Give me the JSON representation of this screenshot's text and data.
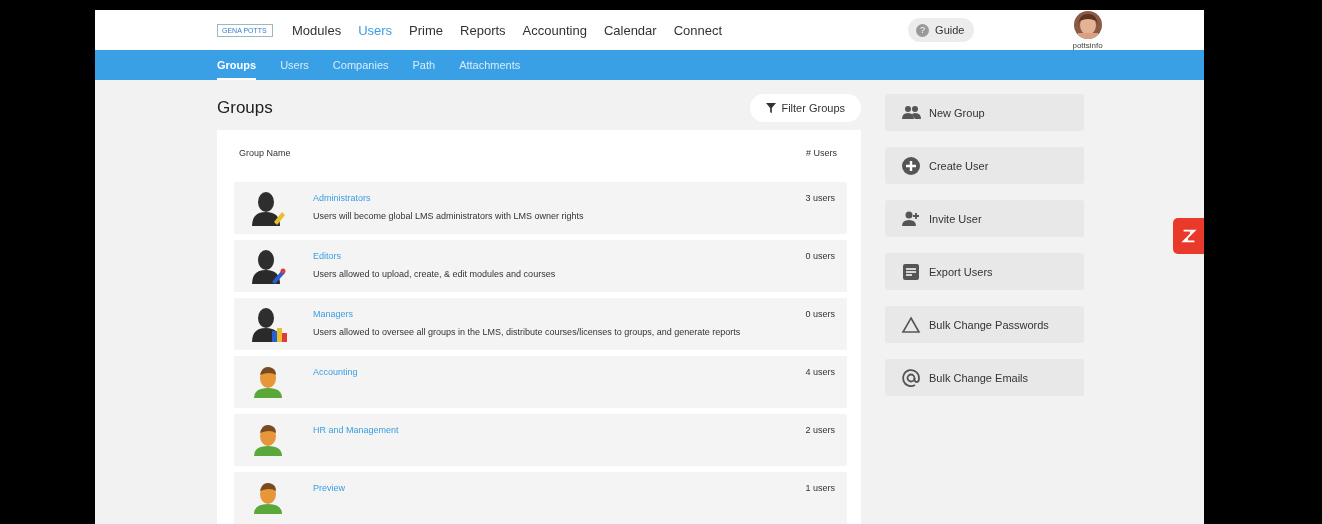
{
  "header": {
    "logo": "GENA POTTS",
    "nav": [
      {
        "label": "Modules",
        "selected": false
      },
      {
        "label": "Users",
        "selected": true
      },
      {
        "label": "Prime",
        "selected": false
      },
      {
        "label": "Reports",
        "selected": false
      },
      {
        "label": "Accounting",
        "selected": false
      },
      {
        "label": "Calendar",
        "selected": false
      },
      {
        "label": "Connect",
        "selected": false
      }
    ],
    "guide": {
      "icon": "?",
      "label": "Guide"
    },
    "user": {
      "name": "pottsinfo"
    }
  },
  "subnav": [
    {
      "label": "Groups",
      "selected": true
    },
    {
      "label": "Users",
      "selected": false
    },
    {
      "label": "Companies",
      "selected": false
    },
    {
      "label": "Path",
      "selected": false
    },
    {
      "label": "Attachments",
      "selected": false
    }
  ],
  "page": {
    "title": "Groups",
    "filter": "Filter Groups"
  },
  "table": {
    "columns": [
      "Group Name",
      "# Users"
    ],
    "rows": [
      {
        "kind": "admin",
        "name": "Administrators",
        "description": "Users will become global LMS administrators with LMS owner rights",
        "count": "3 users"
      },
      {
        "kind": "editor",
        "name": "Editors",
        "description": "Users allowed to upload, create, & edit modules and courses",
        "count": "0 users"
      },
      {
        "kind": "manager",
        "name": "Managers",
        "description": "Users allowed to oversee all groups in the LMS, distribute courses/licenses to groups, and generate reports",
        "count": "0 users"
      },
      {
        "kind": "user",
        "name": "Accounting",
        "count": "4 users"
      },
      {
        "kind": "user",
        "name": "HR and Management",
        "count": "2 users"
      },
      {
        "kind": "user",
        "name": "Preview",
        "count": "1 users"
      }
    ]
  },
  "actions": [
    {
      "kind": "group",
      "label": "New Group"
    },
    {
      "kind": "create",
      "label": "Create User"
    },
    {
      "kind": "invite",
      "label": "Invite User"
    },
    {
      "kind": "export",
      "label": "Export Users"
    },
    {
      "kind": "password",
      "label": "Bulk Change Passwords"
    },
    {
      "kind": "email",
      "label": "Bulk Change Emails"
    }
  ]
}
